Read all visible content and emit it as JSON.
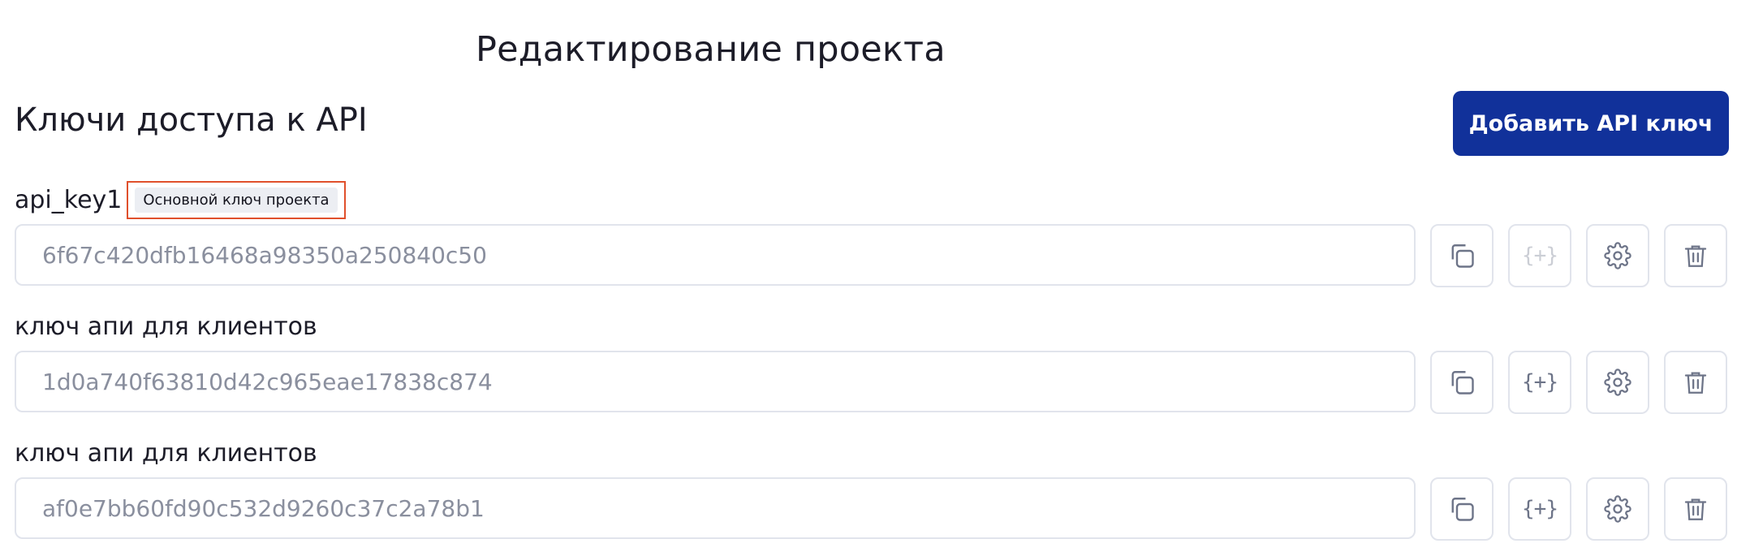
{
  "page": {
    "title": "Редактирование проекта",
    "section_title": "Ключи доступа к API",
    "add_button_label": "Добавить API ключ"
  },
  "colors": {
    "primary": "#11319a",
    "highlight_border": "#e0502c",
    "badge_bg": "#eceef3",
    "border": "#e1e4ec",
    "icon": "#6d7488",
    "muted_text": "#8a8f9e"
  },
  "icons": {
    "copy": "copy-icon",
    "json": "braces-plus-icon",
    "settings": "gear-icon",
    "delete": "trash-icon",
    "json_glyph": "{+}"
  },
  "keys": [
    {
      "name": "api_key1",
      "badge": "Основной ключ проекта",
      "value": "6f67c420dfb16468a98350a250840c50",
      "json_disabled": true
    },
    {
      "name": "ключ апи для клиентов",
      "value": "1d0a740f63810d42c965eae17838c874",
      "json_disabled": false
    },
    {
      "name": "ключ апи для клиентов",
      "value": "af0e7bb60fd90c532d9260c37c2a78b1",
      "json_disabled": false
    }
  ]
}
